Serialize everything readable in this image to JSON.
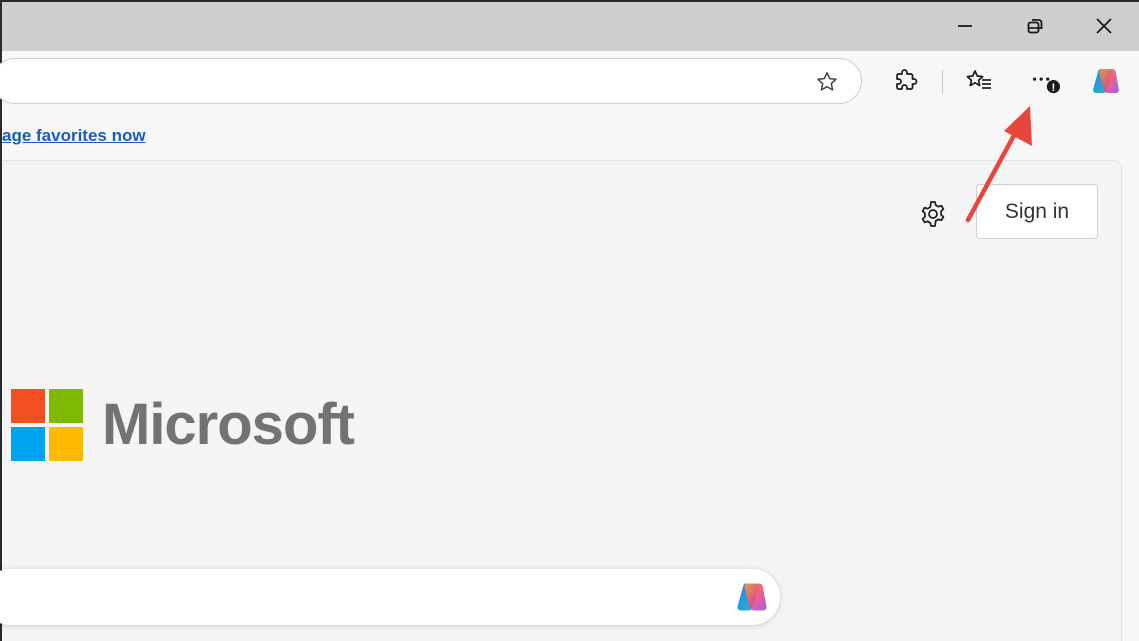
{
  "window": {
    "controls": {
      "minimize_icon": "minimize-icon",
      "restore_icon": "restore-icon",
      "close_icon": "close-icon"
    }
  },
  "toolbar": {
    "address_value": "",
    "favorite_star_icon": "star-outline-icon",
    "icons": [
      "extensions-icon",
      "favorites-icon",
      "more-options-icon",
      "copilot-icon"
    ],
    "more_badge": "!"
  },
  "favorites_bar": {
    "link_text": "age favorites now"
  },
  "page": {
    "sign_in_label": "Sign in",
    "settings_icon": "gear-icon",
    "brand_wordmark": "Microsoft",
    "search_value": ""
  },
  "colors": {
    "titlebar": "#cfcfcf",
    "link": "#1a5fb4",
    "arrow": "#e8453c",
    "ms_red": "#f25022",
    "ms_green": "#7fba00",
    "ms_blue": "#00a4ef",
    "ms_yellow": "#ffb900",
    "wordmark": "#737373"
  }
}
